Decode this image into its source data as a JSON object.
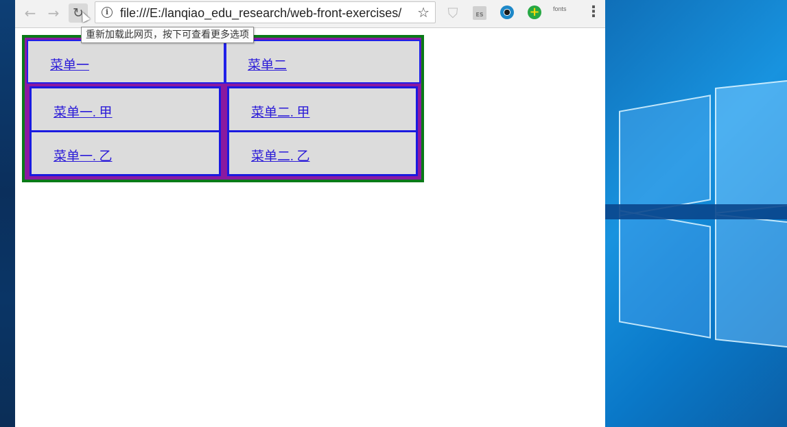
{
  "browser": {
    "url": "file:///E:/lanqiao_edu_research/web-front-exercises/",
    "reload_tooltip": "重新加载此网页，按下可查看更多选项",
    "extensions": {
      "fonts_label": "fonts",
      "es_label": "ES"
    }
  },
  "icons": {
    "back": "←",
    "forward": "→",
    "reload": "↻",
    "info": "i",
    "star": "☆",
    "shield": "⛉",
    "plus": "+",
    "menu": "⋮"
  },
  "menu": {
    "top": [
      {
        "label": "菜单一"
      },
      {
        "label": "菜单二"
      }
    ],
    "sub_left": [
      {
        "label": "菜单一. 甲"
      },
      {
        "label": "菜单一. 乙"
      }
    ],
    "sub_right": [
      {
        "label": "菜单二. 甲"
      },
      {
        "label": "菜单二. 乙"
      }
    ]
  },
  "colors": {
    "outer_border": "#0a7a18",
    "inner_fill": "#8a1aa0",
    "cell_border": "#2020e8",
    "cell_bg": "#dcdcdc",
    "link": "#2a1ad8"
  }
}
